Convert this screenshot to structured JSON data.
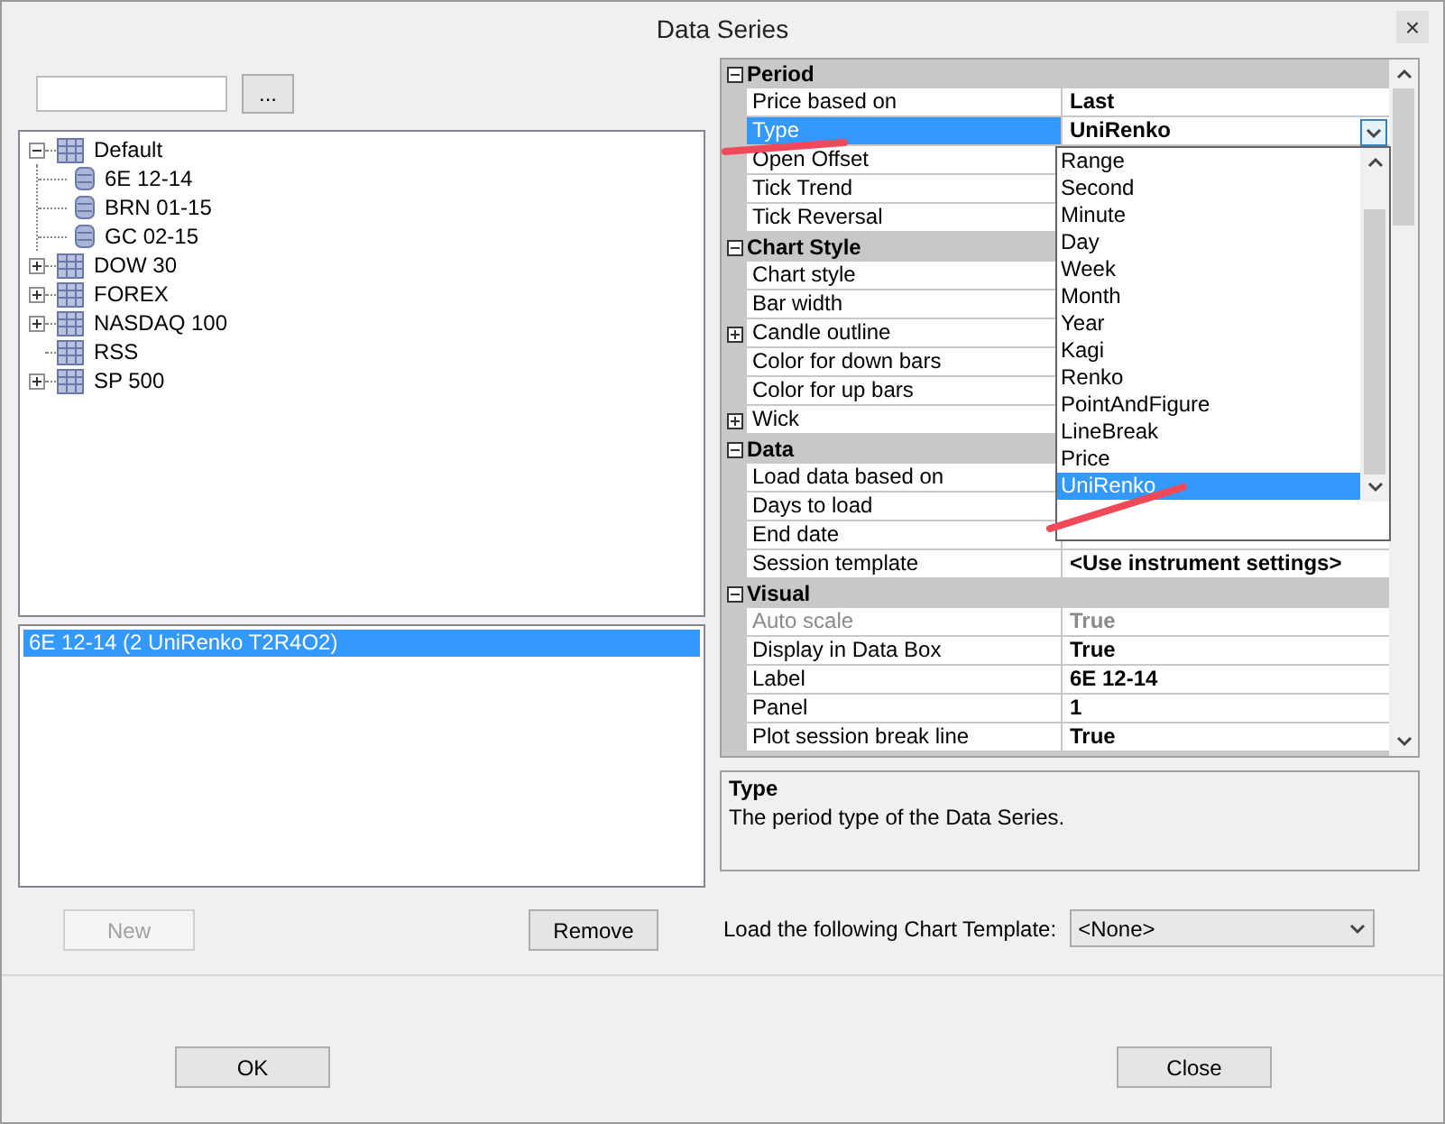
{
  "window": {
    "title": "Data Series",
    "close": "×"
  },
  "browse_button": "...",
  "tree": [
    {
      "label": "Default",
      "expanded": true,
      "children": [
        {
          "label": "6E 12-14"
        },
        {
          "label": "BRN 01-15"
        },
        {
          "label": "GC 02-15"
        }
      ]
    },
    {
      "label": "DOW 30",
      "expanded": false
    },
    {
      "label": "FOREX",
      "expanded": false
    },
    {
      "label": "NASDAQ 100",
      "expanded": false
    },
    {
      "label": "RSS"
    },
    {
      "label": "SP 500",
      "expanded": false
    }
  ],
  "series_list": [
    {
      "label": "6E 12-14 (2 UniRenko T2R4O2)",
      "selected": true
    }
  ],
  "series_buttons": [
    {
      "label": "New",
      "disabled": true
    },
    {
      "label": "Remove",
      "disabled": false
    }
  ],
  "property_grid": {
    "categories": [
      {
        "name": "Period",
        "expanded": true,
        "properties": [
          {
            "name": "Price based on",
            "value": "Last",
            "selected": false,
            "disabled": false,
            "expander": false
          },
          {
            "name": "Type",
            "value": "UniRenko",
            "selected": true,
            "disabled": false,
            "expander": false
          },
          {
            "name": "Open Offset",
            "selected": false,
            "disabled": false,
            "expander": false
          },
          {
            "name": "Tick Trend",
            "selected": false,
            "disabled": false,
            "expander": false
          },
          {
            "name": "Tick Reversal",
            "selected": false,
            "disabled": false,
            "expander": false
          }
        ]
      },
      {
        "name": "Chart Style",
        "expanded": true,
        "properties": [
          {
            "name": "Chart style",
            "selected": false,
            "disabled": false,
            "expander": false
          },
          {
            "name": "Bar width",
            "selected": false,
            "disabled": false,
            "expander": false
          },
          {
            "name": "Candle outline",
            "selected": false,
            "disabled": false,
            "expander": true
          },
          {
            "name": "Color for down bars",
            "selected": false,
            "disabled": false,
            "expander": false
          },
          {
            "name": "Color for up bars",
            "selected": false,
            "disabled": false,
            "expander": false
          },
          {
            "name": "Wick",
            "selected": false,
            "disabled": false,
            "expander": true
          }
        ]
      },
      {
        "name": "Data",
        "expanded": true,
        "properties": [
          {
            "name": "Load data based on",
            "selected": false,
            "disabled": false,
            "expander": false
          },
          {
            "name": "Days to load",
            "selected": false,
            "disabled": false,
            "expander": false
          },
          {
            "name": "End date",
            "selected": false,
            "disabled": false,
            "expander": false
          },
          {
            "name": "Session template",
            "value": "<Use instrument settings>",
            "selected": false,
            "disabled": false,
            "expander": false
          }
        ]
      },
      {
        "name": "Visual",
        "expanded": true,
        "properties": [
          {
            "name": "Auto scale",
            "value": "True",
            "selected": false,
            "disabled": true,
            "expander": false
          },
          {
            "name": "Display in Data Box",
            "value": "True",
            "selected": false,
            "disabled": false,
            "expander": false
          },
          {
            "name": "Label",
            "value": "6E 12-14",
            "selected": false,
            "disabled": false,
            "expander": false
          },
          {
            "name": "Panel",
            "value": "1",
            "selected": false,
            "disabled": false,
            "expander": false
          },
          {
            "name": "Plot session break line",
            "value": "True",
            "selected": false,
            "disabled": false,
            "expander": false
          }
        ]
      }
    ]
  },
  "type_dropdown": {
    "items": [
      {
        "label": "Range",
        "selected": false
      },
      {
        "label": "Second",
        "selected": false
      },
      {
        "label": "Minute",
        "selected": false
      },
      {
        "label": "Day",
        "selected": false
      },
      {
        "label": "Week",
        "selected": false
      },
      {
        "label": "Month",
        "selected": false
      },
      {
        "label": "Year",
        "selected": false
      },
      {
        "label": "Kagi",
        "selected": false
      },
      {
        "label": "Renko",
        "selected": false
      },
      {
        "label": "PointAndFigure",
        "selected": false
      },
      {
        "label": "LineBreak",
        "selected": false
      },
      {
        "label": "Price",
        "selected": false
      },
      {
        "label": "UniRenko",
        "selected": true
      }
    ]
  },
  "description": {
    "title": "Type",
    "text": "The period type of the Data Series."
  },
  "chart_template": {
    "label": "Load the following Chart Template:",
    "value": "<None>"
  },
  "footer_buttons": [
    {
      "label": "OK"
    },
    {
      "label": "Close"
    }
  ]
}
